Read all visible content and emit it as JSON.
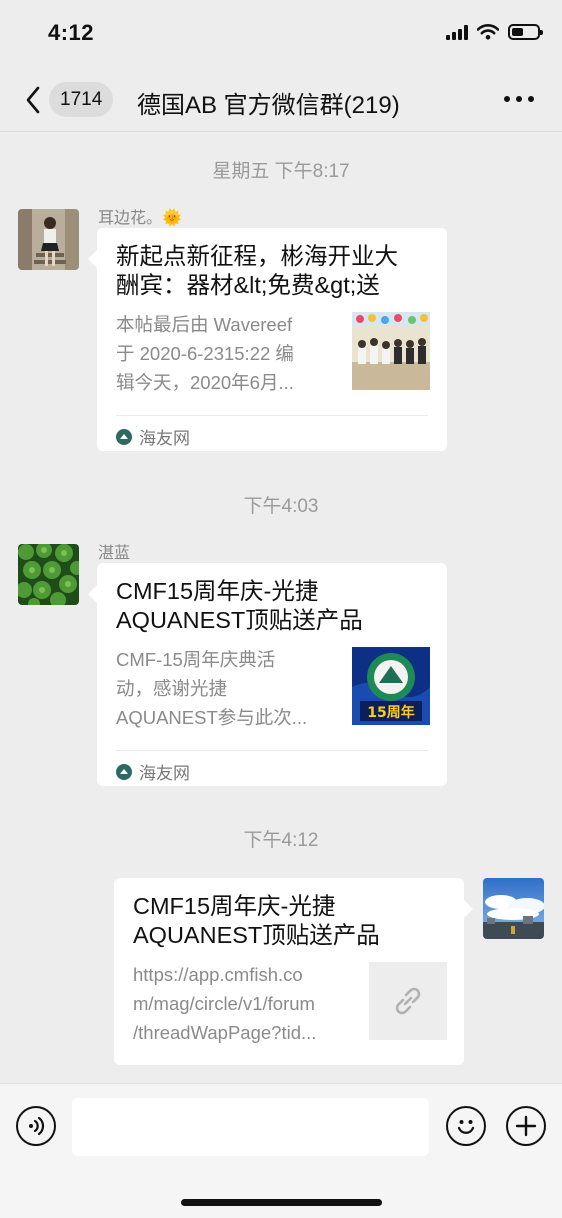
{
  "status_bar": {
    "time": "4:12"
  },
  "nav": {
    "unread_count": "1714",
    "title": "德国AB  官方微信群(219)"
  },
  "messages": [
    {
      "timestamp": "星期五 下午8:17",
      "sender": "耳边花。🌞",
      "title": "新起点新征程，彬海开业大\n酬宾：器材&lt;免费&gt;送",
      "desc": "本帖最后由 Wavereef\n于 2020-6-2315:22 编\n辑今天，2020年6月...",
      "source": "海友网"
    },
    {
      "timestamp": "下午4:03",
      "sender": "湛蓝",
      "title": "CMF15周年庆-光捷\nAQUANEST顶贴送产品",
      "desc": "CMF-15周年庆典活\n动，感谢光捷\nAQUANEST参与此次...",
      "thumb_text": "15周年",
      "source": "海友网"
    },
    {
      "timestamp": "下午4:12",
      "title": "CMF15周年庆-光捷\nAQUANEST顶贴送产品",
      "desc": "https://app.cmfish.co\nm/mag/circle/v1/forum\n/threadWapPage?tid..."
    }
  ],
  "input_bar": {
    "placeholder": ""
  },
  "icons": {
    "back": "chevron-left-icon",
    "more": "more-dots-icon",
    "voice": "voice-icon",
    "emoji": "emoji-icon",
    "add": "plus-icon",
    "link": "link-icon",
    "source": "haiyou-logo-icon"
  },
  "colors": {
    "background": "#ededed",
    "card": "#ffffff",
    "muted_text": "#8a8a8a"
  }
}
